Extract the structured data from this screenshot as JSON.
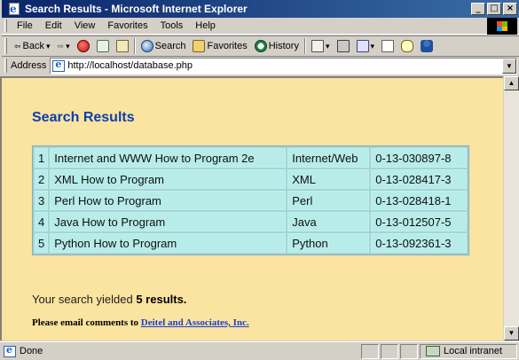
{
  "window": {
    "title": "Search Results - Microsoft Internet Explorer",
    "controls": [
      "_",
      "□",
      "×"
    ]
  },
  "menu": {
    "items": [
      "File",
      "Edit",
      "View",
      "Favorites",
      "Tools",
      "Help"
    ]
  },
  "toolbar": {
    "back": "Back",
    "search": "Search",
    "favorites": "Favorites",
    "history": "History"
  },
  "address": {
    "label": "Address",
    "url": "http://localhost/database.php"
  },
  "page": {
    "heading": "Search Results",
    "rows": [
      [
        "1",
        "Internet and WWW How to Program 2e",
        "Internet/Web",
        "0-13-030897-8"
      ],
      [
        "2",
        "XML How to Program",
        "XML",
        "0-13-028417-3"
      ],
      [
        "3",
        "Perl How to Program",
        "Perl",
        "0-13-028418-1"
      ],
      [
        "4",
        "Java How to Program",
        "Java",
        "0-13-012507-5"
      ],
      [
        "5",
        "Python How to Program",
        "Python",
        "0-13-092361-3"
      ]
    ],
    "yield_prefix": "Your search yielded ",
    "yield_count": "5 results.",
    "comments_prefix": "Please email comments to ",
    "comments_link": "Deitel and Associates, Inc."
  },
  "status": {
    "text": "Done",
    "zone": "Local intranet"
  },
  "colors": {
    "page_background": "#fbe3a0",
    "heading": "#0b3fb0",
    "table_cell": "#b7ece9",
    "link": "#1a3fcc"
  }
}
